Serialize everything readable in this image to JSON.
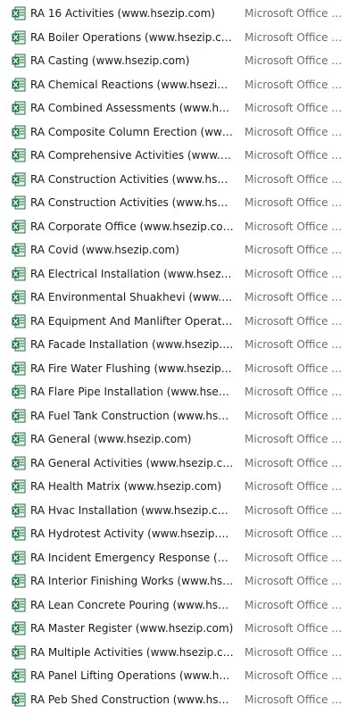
{
  "icon": "excel-file-icon",
  "colors": {
    "icon_green": "#1f7244",
    "icon_light": "#e9f5ec",
    "type_text": "#6d6d6d"
  },
  "files": [
    {
      "name": "RA 16 Activities (www.hsezip.com)",
      "type": "Microsoft Office E..."
    },
    {
      "name": "RA Boiler Operations (www.hsezip.com)",
      "type": "Microsoft Office E..."
    },
    {
      "name": "RA Casting (www.hsezip.com)",
      "type": "Microsoft Office E..."
    },
    {
      "name": "RA Chemical Reactions (www.hsezip.com)",
      "type": "Microsoft Office E..."
    },
    {
      "name": "RA Combined Assessments (www.hsezip....",
      "type": "Microsoft Office E..."
    },
    {
      "name": "RA Composite Column Erection (www.hs...",
      "type": "Microsoft Office E..."
    },
    {
      "name": "RA Comprehensive Activities (www.hsezi...",
      "type": "Microsoft Office E..."
    },
    {
      "name": "RA Construction Activities (www.hsezip.c...",
      "type": "Microsoft Office E..."
    },
    {
      "name": "RA Construction Activities (www.hsezip.c...",
      "type": "Microsoft Office E..."
    },
    {
      "name": "RA Corporate Office (www.hsezip.com)",
      "type": "Microsoft Office E..."
    },
    {
      "name": "RA Covid (www.hsezip.com)",
      "type": "Microsoft Office E..."
    },
    {
      "name": "RA Electrical Installation (www.hsezip.co...",
      "type": "Microsoft Office E..."
    },
    {
      "name": "RA Environmental Shuakhevi (www.hsezi...",
      "type": "Microsoft Office E..."
    },
    {
      "name": "RA Equipment And Manlifter Operations ...",
      "type": "Microsoft Office E..."
    },
    {
      "name": "RA Facade Installation (www.hsezip.com)",
      "type": "Microsoft Office E..."
    },
    {
      "name": "RA Fire Water Flushing (www.hsezip.com)",
      "type": "Microsoft Office E..."
    },
    {
      "name": "RA Flare Pipe Installation (www.hsezip.co...",
      "type": "Microsoft Office E..."
    },
    {
      "name": "RA Fuel Tank Construction (www.hsezip....",
      "type": "Microsoft Office E..."
    },
    {
      "name": "RA General (www.hsezip.com)",
      "type": "Microsoft Office E..."
    },
    {
      "name": "RA General Activities (www.hsezip.com)",
      "type": "Microsoft Office E..."
    },
    {
      "name": "RA Health Matrix (www.hsezip.com)",
      "type": "Microsoft Office E..."
    },
    {
      "name": "RA Hvac Installation (www.hsezip.com)",
      "type": "Microsoft Office E..."
    },
    {
      "name": "RA Hydrotest Activity (www.hsezip.com)",
      "type": "Microsoft Office E..."
    },
    {
      "name": "RA Incident Emergency Response (www....",
      "type": "Microsoft Office E..."
    },
    {
      "name": "RA Interior Finishing Works (www.hsezip....",
      "type": "Microsoft Office E..."
    },
    {
      "name": "RA Lean Concrete Pouring (www.hsezip....",
      "type": "Microsoft Office E..."
    },
    {
      "name": "RA Master Register (www.hsezip.com)",
      "type": "Microsoft Office E..."
    },
    {
      "name": "RA Multiple Activities (www.hsezip.com)",
      "type": "Microsoft Office E..."
    },
    {
      "name": "RA Panel Lifting Operations (www.hsezip...",
      "type": "Microsoft Office E..."
    },
    {
      "name": "RA Peb Shed Construction (www.hsezip....",
      "type": "Microsoft Office E..."
    }
  ]
}
